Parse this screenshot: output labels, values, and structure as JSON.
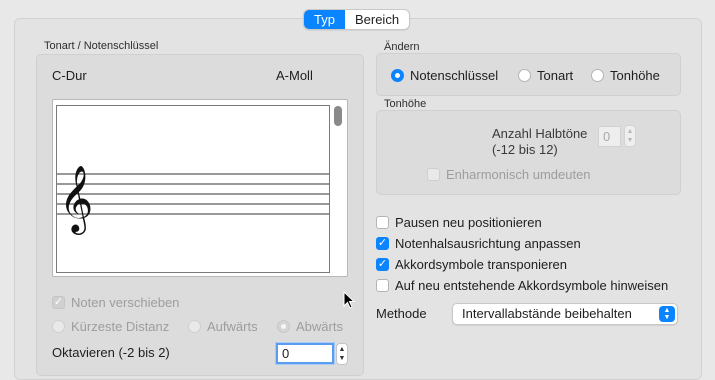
{
  "tabs": {
    "active": "Typ",
    "other": "Bereich"
  },
  "left": {
    "group_title": "Tonart / Notenschlüssel",
    "key_major": "C-Dur",
    "key_minor": "A-Moll",
    "move_notes_label": "Noten verschieben",
    "move_notes_checked": true,
    "direction": [
      {
        "label": "Kürzeste Distanz",
        "selected": false
      },
      {
        "label": "Aufwärts",
        "selected": false
      },
      {
        "label": "Abwärts",
        "selected": true
      }
    ],
    "octave_label": "Oktavieren (-2 bis 2)",
    "octave_value": "0"
  },
  "change": {
    "title": "Ändern",
    "options": [
      {
        "label": "Notenschlüssel",
        "selected": true
      },
      {
        "label": "Tonart",
        "selected": false
      },
      {
        "label": "Tonhöhe",
        "selected": false
      }
    ]
  },
  "pitch": {
    "title": "Tonhöhe",
    "semitones_label_1": "Anzahl Halbtöne",
    "semitones_label_2": "(-12 bis 12)",
    "semitones_value": "0",
    "enharmonic_label": "Enharmonisch umdeuten"
  },
  "options": [
    {
      "label": "Pausen neu positionieren",
      "checked": false
    },
    {
      "label": "Notenhalsausrichtung anpassen",
      "checked": true
    },
    {
      "label": "Akkordsymbole transponieren",
      "checked": true
    },
    {
      "label": "Auf neu entstehende Akkordsymbole hinweisen",
      "checked": false
    }
  ],
  "method": {
    "label": "Methode",
    "value": "Intervallabstände beibehalten"
  },
  "colors": {
    "accent": "#0a84ff",
    "focus_ring": "#5a9cf0"
  }
}
